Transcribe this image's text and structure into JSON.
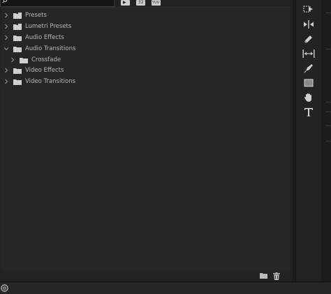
{
  "effects_panel": {
    "tree": [
      {
        "label": "Presets",
        "icon": "preset-folder-icon",
        "expanded": false,
        "depth": 0
      },
      {
        "label": "Lumetri Presets",
        "icon": "preset-folder-icon",
        "expanded": false,
        "depth": 0
      },
      {
        "label": "Audio Effects",
        "icon": "folder-icon",
        "expanded": false,
        "depth": 0
      },
      {
        "label": "Audio Transitions",
        "icon": "folder-icon",
        "expanded": true,
        "depth": 0
      },
      {
        "label": "Crossfade",
        "icon": "folder-icon",
        "expanded": false,
        "depth": 1
      },
      {
        "label": "Video Effects",
        "icon": "folder-icon",
        "expanded": false,
        "depth": 0
      },
      {
        "label": "Video Transitions",
        "icon": "folder-icon",
        "expanded": false,
        "depth": 0
      }
    ],
    "filter_buttons": [
      {
        "icon": "accelerated-effects-icon",
        "glyph": "▶"
      },
      {
        "icon": "32bit-color-icon",
        "glyph": "32"
      },
      {
        "icon": "yuv-effects-icon",
        "glyph": "YUV"
      }
    ],
    "bottom_actions": [
      {
        "icon": "new-bin-folder-icon"
      },
      {
        "icon": "delete-trash-icon"
      }
    ]
  },
  "tools": [
    {
      "name": "track-select-forward-tool",
      "icon": "track-select-forward-icon"
    },
    {
      "name": "ripple-edit-tool",
      "icon": "ripple-edit-icon"
    },
    {
      "name": "razor-tool",
      "icon": "razor-icon"
    },
    {
      "name": "slip-tool",
      "icon": "slip-icon"
    },
    {
      "name": "pen-tool",
      "icon": "pen-icon"
    },
    {
      "name": "rectangle-tool",
      "icon": "rectangle-icon"
    },
    {
      "name": "hand-tool",
      "icon": "hand-icon"
    },
    {
      "name": "type-tool",
      "icon": "type-icon"
    }
  ],
  "colors": {
    "panel_bg": "#232323",
    "tree_bg": "#262626",
    "text": "#b8b8b8",
    "icon": "#d0d0d0"
  }
}
